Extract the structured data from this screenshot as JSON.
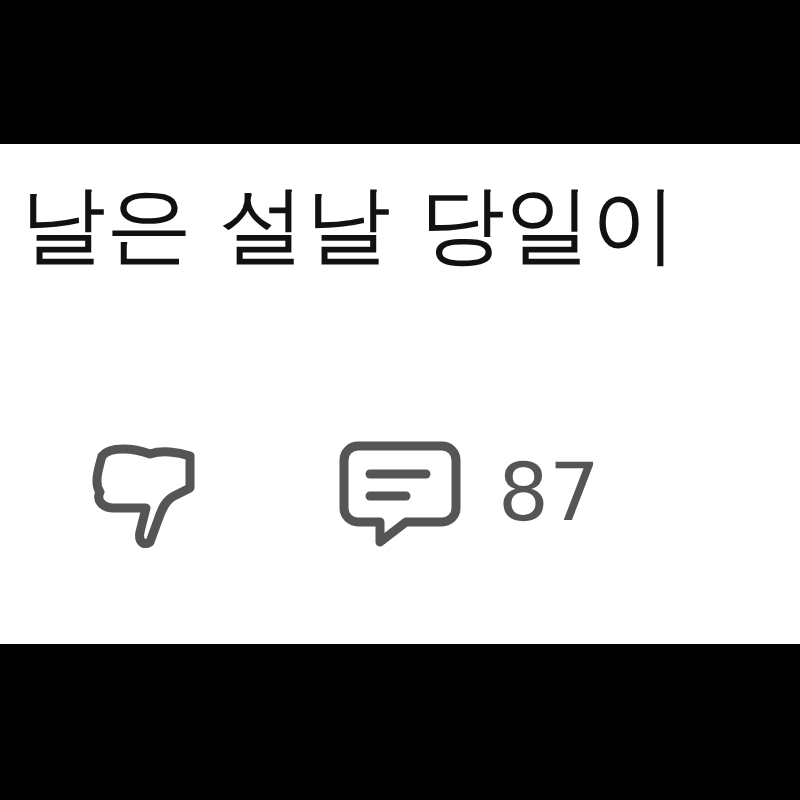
{
  "post": {
    "text": "날은 설날 당일이"
  },
  "actions": {
    "comment_count": "87"
  }
}
